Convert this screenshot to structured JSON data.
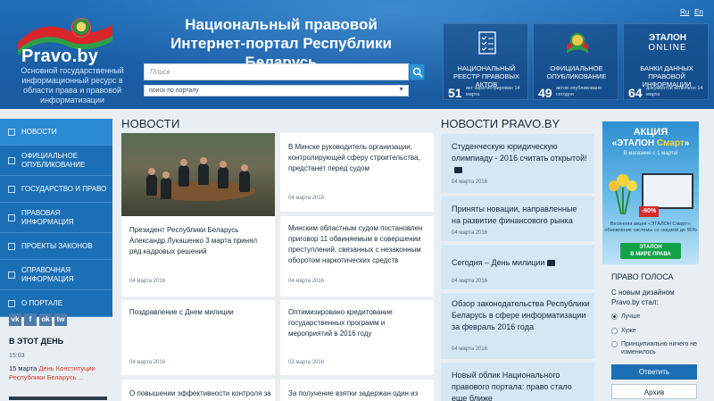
{
  "header": {
    "logo_text": "Pravo.by",
    "tagline": "Основной государственный информационный ресурс в области права и правовой информатизации",
    "title_line1": "Национальный правовой",
    "title_line2": "Интернет-портал Республики Беларусь",
    "search_placeholder": "Поиск",
    "search_scope": "поиск по порталу",
    "lang_ru": "Ru",
    "lang_en": "En",
    "tiles": [
      {
        "title": "НАЦИОНАЛЬНЫЙ РЕЕСТР ПРАВОВЫХ АКТОВ",
        "number": "51",
        "sub": "акт зарегистрирован 14 марта",
        "icon": "document-checklist-icon"
      },
      {
        "title": "ОФИЦИАЛЬНОЕ ОПУБЛИКОВАНИЕ",
        "number": "49",
        "sub": "актов опубликовано сегодня",
        "icon": "state-emblem-icon"
      },
      {
        "title": "БАНКИ ДАННЫХ ПРАВОВОЙ ИНФОРМАЦИИ",
        "number": "64",
        "sub": "документов включено 14 марта",
        "icon": "etalon-online-logo",
        "logo_line1": "ЭТАЛОН",
        "logo_line2": "ONLINE"
      }
    ]
  },
  "sidebar": {
    "items": [
      {
        "label": "НОВОСТИ"
      },
      {
        "label": "ОФИЦИАЛЬНОЕ ОПУБЛИКОВАНИЕ"
      },
      {
        "label": "ГОСУДАРСТВО И ПРАВО"
      },
      {
        "label": "ПРАВОВАЯ ИНФОРМАЦИЯ"
      },
      {
        "label": "ПРОЕКТЫ ЗАКОНОВ"
      },
      {
        "label": "СПРАВОЧНАЯ ИНФОРМАЦИЯ"
      },
      {
        "label": "О ПОРТАЛЕ"
      }
    ],
    "social": [
      "vk",
      "f",
      "ok",
      "tw"
    ],
    "day_title": "В ЭТОТ ДЕНЬ",
    "day_time": "15:03",
    "day_date": "15 марта",
    "day_link": "День Конституции Республики Беларусь ..."
  },
  "news": {
    "heading": "НОВОСТИ",
    "items": [
      {
        "title": "Президент Республики Беларусь Александр Лукашенко 3 марта принял ряд кадровых решений",
        "date": "04 марта 2016"
      },
      {
        "title": "В Минске руководитель организации, контролирующей сферу строительства, предстанет перед судом",
        "date": "04 марта 2016"
      },
      {
        "title": "Минским областным судом постановлен приговор 11 обвиняемым в совершении преступлений, связанных с незаконным оборотом наркотических средств",
        "date": "04 марта 2016"
      },
      {
        "title": "Поздравление с Днем милиции",
        "date": "04 марта 2016"
      },
      {
        "title": "Оптимизировано кредитование государственных программ и мероприятий в 2016 году",
        "date": "03 марта 2016"
      },
      {
        "title": "О повышении эффективности контроля за",
        "date": ""
      },
      {
        "title": "За получение взятки задержан один из",
        "date": ""
      }
    ]
  },
  "pravo_news": {
    "heading": "НОВОСТИ PRAVO.BY",
    "items": [
      {
        "title": "Студенческую юридическую олимпиаду - 2016 считать открытой!",
        "date": "04 марта 2016"
      },
      {
        "title": "Приняты новации, направленные на развитие финансового рынка",
        "date": "04 марта 2016"
      },
      {
        "title": "Сегодня – День милиции",
        "date": "04 марта 2016"
      },
      {
        "title": "Обзор законодательства Республики Беларусь в сфере информатизации за февраль 2016 года",
        "date": "04 марта 2016"
      },
      {
        "title": "Новый облик Национального правового портала: право стало еще ближе",
        "date": ""
      }
    ]
  },
  "ad": {
    "line1": "АКЦИЯ",
    "line2a": "«ЭТАЛОН ",
    "line2b": "Смарт",
    "line2c": "»",
    "line3": "В магазине с 1 марта!",
    "badge": "-90%",
    "footer": "Весенняя акция «ЭТАЛОН Смарт»: обновление системы со скидкой до 90%",
    "logo_line1": "ЭТАЛОН",
    "logo_line2": "В МИРЕ ПРАВА"
  },
  "poll": {
    "heading": "ПРАВО ГОЛОСА",
    "question": "С новым дизайном Pravo.by стал:",
    "options": [
      "Лучше",
      "Хуже",
      "Принципиально ничего не изменилось"
    ],
    "vote_button": "Ответить",
    "archive_button": "Архив"
  }
}
